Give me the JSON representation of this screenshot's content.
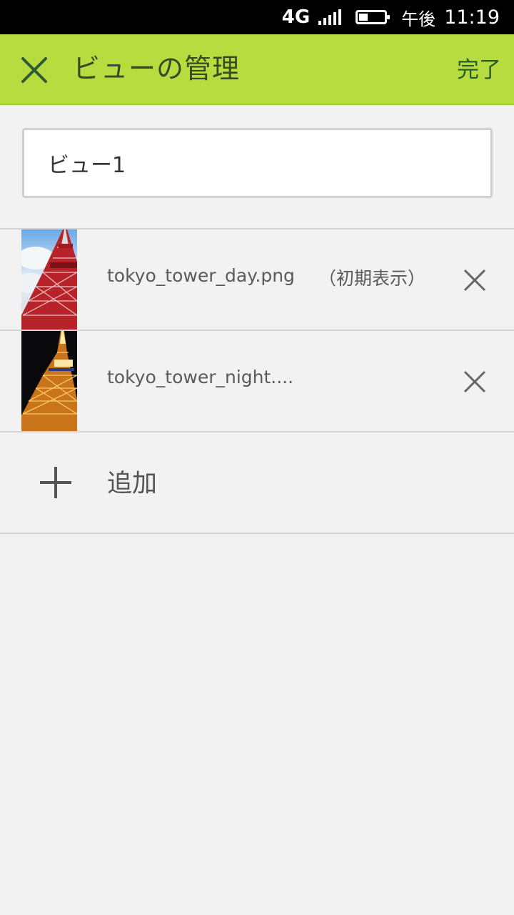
{
  "status_bar": {
    "network": "4G",
    "ampm": "午後",
    "time": "11:19"
  },
  "app_bar": {
    "title": "ビューの管理",
    "done_label": "完了",
    "close_icon": "close-icon"
  },
  "view_name": {
    "value": "ビュー1"
  },
  "images": [
    {
      "file_name": "tokyo_tower_day.png",
      "tag": "（初期表示）",
      "thumbnail": "tokyo-tower-day-thumbnail"
    },
    {
      "file_name": "tokyo_tower_night....",
      "tag": "",
      "thumbnail": "tokyo-tower-night-thumbnail"
    }
  ],
  "add_item": {
    "label": "追加",
    "icon": "plus-icon"
  },
  "colors": {
    "app_bar": "#b6dc40",
    "background": "#f2f2f2",
    "done_text": "#2a5a2a"
  }
}
